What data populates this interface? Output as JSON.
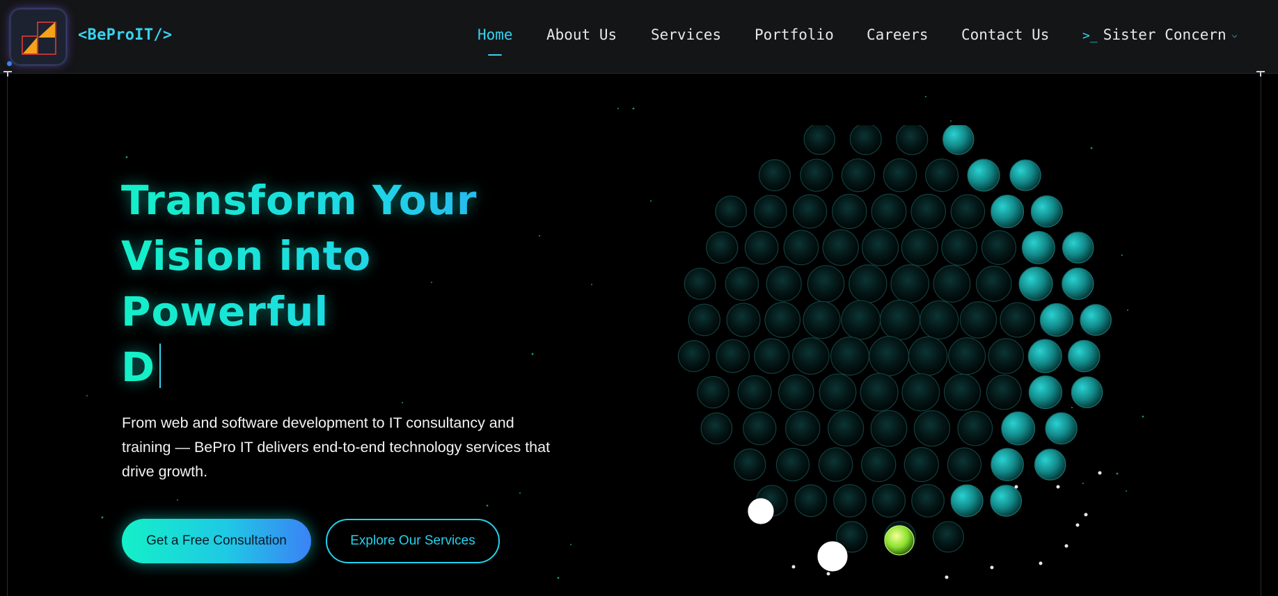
{
  "brand": {
    "name": "<BeProIT/>",
    "logo_icon": "logo-mark-icon",
    "colors": {
      "accent": "#38d3ee",
      "logo_orange": "#f6a21a",
      "logo_red": "#e53935"
    }
  },
  "nav": {
    "items": [
      {
        "label": "Home",
        "active": true
      },
      {
        "label": "About Us",
        "active": false
      },
      {
        "label": "Services",
        "active": false
      },
      {
        "label": "Portfolio",
        "active": false
      },
      {
        "label": "Careers",
        "active": false
      },
      {
        "label": "Contact Us",
        "active": false
      }
    ],
    "sister": {
      "prompt": ">_",
      "label": "Sister Concern",
      "icon": "chevron-down-icon"
    }
  },
  "hero": {
    "headline_lines": [
      "Transform Your",
      "Vision into",
      "Powerful"
    ],
    "typed_text": "D",
    "subtext": "From web and software development to IT consultancy and training — BePro IT delivers end-to-end technology services that drive growth.",
    "cta_primary": "Get a Free Consultation",
    "cta_secondary": "Explore Our Services",
    "colors": {
      "gradient_start": "#14f0c8",
      "gradient_end": "#3b82f6",
      "sphere_highlight": "#1aa8a8"
    }
  }
}
